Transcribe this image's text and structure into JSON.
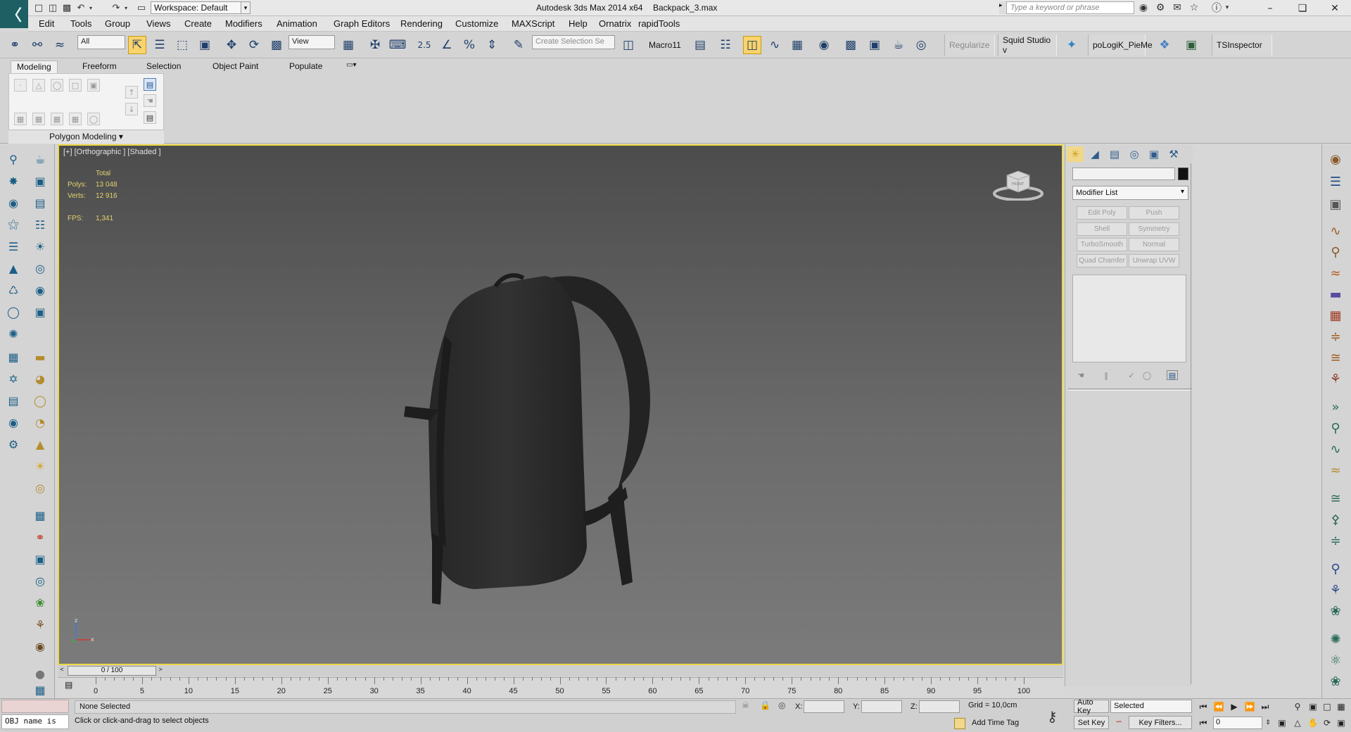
{
  "titlebar": {
    "workspace": "Workspace: Default",
    "app_title": "Autodesk 3ds Max  2014 x64",
    "file_name": "Backpack_3.max",
    "search_placeholder": "Type a keyword or phrase"
  },
  "menu": [
    "Edit",
    "Tools",
    "Group",
    "Views",
    "Create",
    "Modifiers",
    "Animation",
    "Graph Editors",
    "Rendering",
    "Customize",
    "MAXScript",
    "Help",
    "Ornatrix",
    "rapidTools"
  ],
  "toolbar": {
    "selection_filter": "All",
    "ref_coord": "View",
    "snaps_label": "2.5",
    "create_selection_set": "Create Selection Se",
    "macro": "Macro11",
    "regularize": "Regularize",
    "squid": "Squid Studio v",
    "pologik": "poLogiK_PieMe",
    "tsinspector": "TSInspector"
  },
  "ribbon": {
    "tabs": [
      "Modeling",
      "Freeform",
      "Selection",
      "Object Paint",
      "Populate"
    ],
    "panel_label": "Polygon Modeling"
  },
  "viewport": {
    "label": "[+] [Orthographic ] [Shaded ]",
    "stats": {
      "total_label": "Total",
      "polys_label": "Polys:",
      "polys": "13 048",
      "verts_label": "Verts:",
      "verts": "12 916",
      "fps_label": "FPS:",
      "fps": "1,341"
    },
    "viewcube_text": "FRONT",
    "axis": {
      "z": "z",
      "x": "x"
    }
  },
  "command_panel": {
    "modifier_list": "Modifier List",
    "buttons": [
      "Edit Poly",
      "Push",
      "Shell",
      "Symmetry",
      "TurboSmooth",
      "Normal",
      "Quad Chamfer",
      "Unwrap UVW"
    ]
  },
  "timeline": {
    "slider": "0 / 100",
    "ticks": [
      "0",
      "5",
      "10",
      "15",
      "20",
      "25",
      "30",
      "35",
      "40",
      "45",
      "50",
      "55",
      "60",
      "65",
      "70",
      "75",
      "80",
      "85",
      "90",
      "95",
      "100"
    ]
  },
  "status": {
    "maxscript": "OBJ name is",
    "selection": "None Selected",
    "prompt": "Click or click-and-drag to select objects",
    "x_label": "X:",
    "y_label": "Y:",
    "z_label": "Z:",
    "grid": "Grid = 10,0cm",
    "add_time_tag": "Add Time Tag",
    "auto_key": "Auto Key",
    "set_key": "Set Key",
    "selected": "Selected",
    "key_filters": "Key Filters...",
    "frame": "0"
  },
  "colors": {
    "viewport_border": "#ecd845",
    "stats_text": "#e3d36f",
    "active_tool": "#f9d36b"
  }
}
